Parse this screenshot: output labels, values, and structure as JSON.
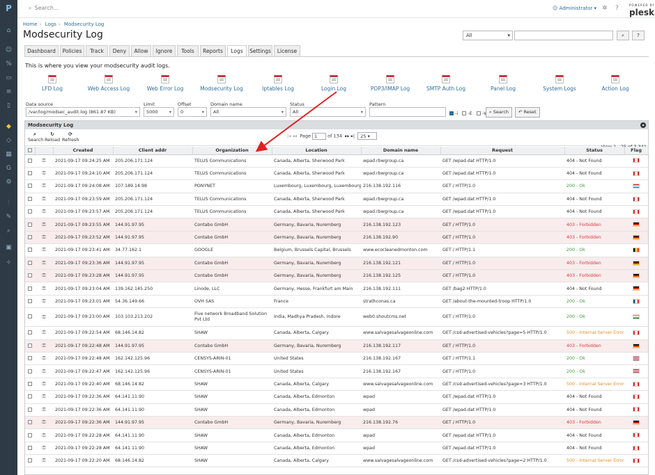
{
  "rail": {
    "logo": "P",
    "icons": [
      "home-icon",
      "user-icon",
      "percent-icon",
      "monitor-icon",
      "bars-icon",
      "book-icon",
      "puzzle-icon",
      "layers-icon",
      "grid-icon",
      "google-icon",
      "gear-icon",
      "sliders-icon",
      "wrench-icon",
      "zoom-icon",
      "package-icon",
      "tool-icon"
    ]
  },
  "topbar": {
    "search_placeholder": "Search...",
    "user": "Administrator",
    "brand_small": "POWERED BY",
    "brand": "plesk"
  },
  "breadcrumb": [
    "Home",
    "Logs",
    "Modsecurity Log"
  ],
  "page_title": "Modsecurity Log",
  "filter": {
    "scope": "All",
    "search_value": "",
    "search_btn": "⌕",
    "help_btn": "?"
  },
  "tabs": [
    "Dashboard",
    "Policies",
    "Track",
    "Deny",
    "Allow",
    "Ignore",
    "Tools",
    "Reports",
    "Logs",
    "Settings",
    "License"
  ],
  "active_tab": "Logs",
  "description": "This is where you view your modsecurity audit logs.",
  "log_links": [
    "LFD Log",
    "Web Access Log",
    "Web Error Log",
    "Modsecurity Log",
    "Iptables Log",
    "Login Log",
    "POP3/IMAP Log",
    "SMTP Auth Log",
    "Panel Log",
    "System Logs",
    "Action Log"
  ],
  "form": {
    "datasource_label": "Data source",
    "datasource_value": "/var/log/modsec_audit.log (861.87 KB)",
    "limit_label": "Limit",
    "limit_value": "5000",
    "offset_label": "Offset",
    "offset_value": "0",
    "domain_label": "Domain name",
    "domain_value": "All",
    "status_label": "Status",
    "status_value": "All",
    "pattern_label": "Pattern",
    "pattern_value": "",
    "opt_i": "-i",
    "opt_e": "-E",
    "opt_w": "-W",
    "search_btn": "Search",
    "reset_btn": "Reset"
  },
  "panel": {
    "title": "Modsecurity Log",
    "toolbar": {
      "search": "Search",
      "reload": "Reload",
      "refresh": "Refresh"
    },
    "pager": {
      "page_label": "Page",
      "page": "1",
      "of": "of 134",
      "per_page": "25"
    },
    "view": "View 1 - 25 of 3,341"
  },
  "columns": [
    "Created",
    "Client addr",
    "Organization",
    "Location",
    "Domain name",
    "Request",
    "Status",
    "Flag"
  ],
  "rows": [
    {
      "created": "2021-09-17 09:24:25 AM",
      "ip": "205.206.171.124",
      "org": "TELUS Communications",
      "loc": "Canada, Alberta, Sherwood Park",
      "domain": "wpad.rbwgroup.ca",
      "req": "GET /wpad.dat HTTP/1.0",
      "status": "404 - Not Found",
      "cls": "nf",
      "flag": "ca",
      "hl": false
    },
    {
      "created": "2021-09-17 09:24:10 AM",
      "ip": "205.206.171.124",
      "org": "TELUS Communications",
      "loc": "Canada, Alberta, Sherwood Park",
      "domain": "wpad.rbwgroup.ca",
      "req": "GET /wpad.dat HTTP/1.0",
      "status": "404 - Not Found",
      "cls": "nf",
      "flag": "ca",
      "hl": false
    },
    {
      "created": "2021-09-17 09:24:08 AM",
      "ip": "107.189.14.98",
      "org": "PONYNET",
      "loc": "Luxembourg, Luxembourg, Luxembourg",
      "domain": "216.138.192.116",
      "req": "GET / HTTP/1.0",
      "status": "200 - Ok",
      "cls": "ok",
      "flag": "lu",
      "hl": false
    },
    {
      "created": "2021-09-17 09:23:59 AM",
      "ip": "205.206.171.124",
      "org": "TELUS Communications",
      "loc": "Canada, Alberta, Sherwood Park",
      "domain": "wpad.rbwgroup.ca",
      "req": "GET /wpad.dat HTTP/1.0",
      "status": "404 - Not Found",
      "cls": "nf",
      "flag": "ca",
      "hl": false
    },
    {
      "created": "2021-09-17 09:23:57 AM",
      "ip": "205.206.171.124",
      "org": "TELUS Communications",
      "loc": "Canada, Alberta, Sherwood Park",
      "domain": "wpad.rbwgroup.ca",
      "req": "GET /wpad.dat HTTP/1.0",
      "status": "404 - Not Found",
      "cls": "nf",
      "flag": "ca",
      "hl": false
    },
    {
      "created": "2021-09-17 09:23:55 AM",
      "ip": "144.91.97.95",
      "org": "Contabo GmbH",
      "loc": "Germany, Bavaria, Nuremberg",
      "domain": "216.138.192.123",
      "req": "GET / HTTP/1.0",
      "status": "403 - Forbidden",
      "cls": "forb",
      "flag": "de",
      "hl": true
    },
    {
      "created": "2021-09-17 09:23:52 AM",
      "ip": "144.91.97.95",
      "org": "Contabo GmbH",
      "loc": "Germany, Bavaria, Nuremberg",
      "domain": "216.138.192.90",
      "req": "GET / HTTP/1.0",
      "status": "403 - Forbidden",
      "cls": "forb",
      "flag": "de",
      "hl": true
    },
    {
      "created": "2021-09-17 09:23:41 AM",
      "ip": "34.77.162.1",
      "org": "GOOGLE",
      "loc": "Belgium, Brussels Capital, Brussels",
      "domain": "www.ecocleanedmonton.com",
      "req": "GET / HTTP/1.1",
      "status": "200 - Ok",
      "cls": "ok",
      "flag": "be",
      "hl": false
    },
    {
      "created": "2021-09-17 09:23:36 AM",
      "ip": "144.91.97.95",
      "org": "Contabo GmbH",
      "loc": "Germany, Bavaria, Nuremberg",
      "domain": "216.138.192.121",
      "req": "GET / HTTP/1.0",
      "status": "403 - Forbidden",
      "cls": "forb",
      "flag": "de",
      "hl": true
    },
    {
      "created": "2021-09-17 09:23:28 AM",
      "ip": "144.91.97.95",
      "org": "Contabo GmbH",
      "loc": "Germany, Bavaria, Nuremberg",
      "domain": "216.138.192.125",
      "req": "GET / HTTP/1.0",
      "status": "403 - Forbidden",
      "cls": "forb",
      "flag": "de",
      "hl": true
    },
    {
      "created": "2021-09-17 09:23:04 AM",
      "ip": "139.162.145.250",
      "org": "Linode, LLC",
      "loc": "Germany, Hesse, Frankfurt am Main",
      "domain": "216.138.192.111",
      "req": "GET /bag2 HTTP/1.0",
      "status": "404 - Not Found",
      "cls": "nf",
      "flag": "de",
      "hl": false
    },
    {
      "created": "2021-09-17 09:23:01 AM",
      "ip": "54.36.149.66",
      "org": "OVH SAS",
      "loc": "France",
      "domain": "strathconas.ca",
      "req": "GET /about-the-mounted-troop HTTP/1.0",
      "status": "200 - Ok",
      "cls": "ok",
      "flag": "fr",
      "hl": false
    },
    {
      "created": "2021-09-17 09:23:00 AM",
      "ip": "103.103.213.202",
      "org": "Five network Broadband Solution Pvt Ltd",
      "loc": "India, Madhya Pradesh, Indore",
      "domain": "web0.shoutcms.net",
      "req": "GET / HTTP/1.0",
      "status": "200 - Ok",
      "cls": "ok",
      "flag": "in",
      "hl": false,
      "tall": true
    },
    {
      "created": "2021-09-17 09:22:54 AM",
      "ip": "68.146.14.82",
      "org": "SHAW",
      "loc": "Canada, Alberta, Calgary",
      "domain": "www.salvagesalvageonline.com",
      "req": "GET /csd-advertised-vehicles?page=5 HTTP/1.0",
      "status": "500 - Internal Server Error",
      "cls": "ise",
      "flag": "ca",
      "hl": false
    },
    {
      "created": "2021-09-17 09:22:48 AM",
      "ip": "144.91.97.95",
      "org": "Contabo GmbH",
      "loc": "Germany, Bavaria, Nuremberg",
      "domain": "216.138.192.117",
      "req": "GET / HTTP/1.0",
      "status": "403 - Forbidden",
      "cls": "forb",
      "flag": "de",
      "hl": true
    },
    {
      "created": "2021-09-17 09:22:48 AM",
      "ip": "162.142.125.96",
      "org": "CENSYS-ARIN-01",
      "loc": "United States",
      "domain": "216.138.192.167",
      "req": "GET / HTTP/1.1",
      "status": "200 - Ok",
      "cls": "ok",
      "flag": "us",
      "hl": false
    },
    {
      "created": "2021-09-17 09:22:47 AM",
      "ip": "162.142.125.96",
      "org": "CENSYS-ARIN-01",
      "loc": "United States",
      "domain": "216.138.192.167",
      "req": "GET / HTTP/1.0",
      "status": "200 - Ok",
      "cls": "ok",
      "flag": "us",
      "hl": false
    },
    {
      "created": "2021-09-17 09:22:40 AM",
      "ip": "68.146.14.82",
      "org": "SHAW",
      "loc": "Canada, Alberta, Calgary",
      "domain": "www.salvagesalvageonline.com",
      "req": "GET /csd-advertised-vehicles?page=3 HTTP/1.0",
      "status": "500 - Internal Server Error",
      "cls": "ise",
      "flag": "ca",
      "hl": false
    },
    {
      "created": "2021-09-17 09:22:36 AM",
      "ip": "64.141.11.90",
      "org": "SHAW",
      "loc": "Canada, Alberta, Edmonton",
      "domain": "wpad",
      "req": "GET /wpad.dat HTTP/1.0",
      "status": "404 - Not Found",
      "cls": "nf",
      "flag": "ca",
      "hl": false
    },
    {
      "created": "2021-09-17 09:22:36 AM",
      "ip": "64.141.11.90",
      "org": "SHAW",
      "loc": "Canada, Alberta, Edmonton",
      "domain": "wpad",
      "req": "GET /wpad.dat HTTP/1.0",
      "status": "404 - Not Found",
      "cls": "nf",
      "flag": "ca",
      "hl": false
    },
    {
      "created": "2021-09-17 09:22:36 AM",
      "ip": "144.91.97.95",
      "org": "Contabo GmbH",
      "loc": "Germany, Bavaria, Nuremberg",
      "domain": "216.138.192.76",
      "req": "GET / HTTP/1.0",
      "status": "403 - Forbidden",
      "cls": "forb",
      "flag": "de",
      "hl": true
    },
    {
      "created": "2021-09-17 09:22:28 AM",
      "ip": "64.141.11.90",
      "org": "SHAW",
      "loc": "Canada, Alberta, Edmonton",
      "domain": "wpad",
      "req": "GET /wpad.dat HTTP/1.0",
      "status": "404 - Not Found",
      "cls": "nf",
      "flag": "ca",
      "hl": false
    },
    {
      "created": "2021-09-17 09:22:28 AM",
      "ip": "64.141.11.90",
      "org": "SHAW",
      "loc": "Canada, Alberta, Edmonton",
      "domain": "wpad",
      "req": "GET /wpad.dat HTTP/1.0",
      "status": "404 - Not Found",
      "cls": "nf",
      "flag": "ca",
      "hl": false
    },
    {
      "created": "2021-09-17 09:22:20 AM",
      "ip": "68.146.14.82",
      "org": "SHAW",
      "loc": "Canada, Alberta, Calgary",
      "domain": "www.salvagesalvageonline.com",
      "req": "GET /csd-advertised-vehicles?page=2 HTTP/1.0",
      "status": "500 - Internal Server Error",
      "cls": "ise",
      "flag": "ca",
      "hl": false
    }
  ],
  "colors": {
    "accent": "#2f6e9c",
    "rail": "#2e3b47",
    "forbidden": "#d83a3a",
    "ok": "#3c9b3c",
    "error": "#e58d2c",
    "highlight_row": "#f8ecec",
    "annotation_arrow": "#e02020"
  }
}
